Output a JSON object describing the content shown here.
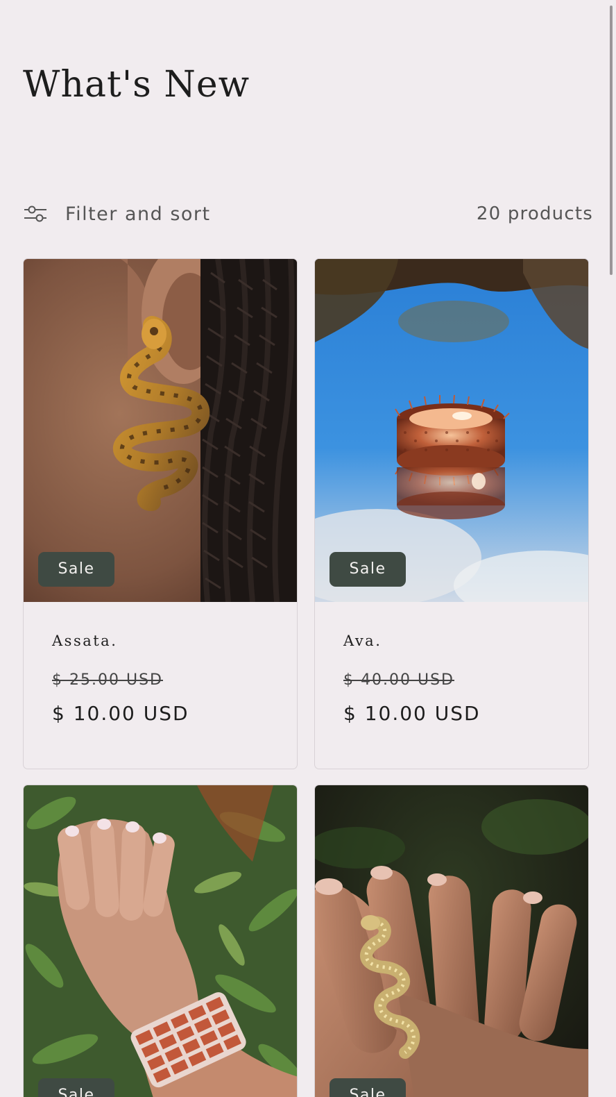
{
  "page": {
    "title": "What's New"
  },
  "toolbar": {
    "filter_label": "Filter and sort",
    "filter_icon": "sliders-icon",
    "product_count": "20 products"
  },
  "products": [
    {
      "name": "Assata.",
      "badge": "Sale",
      "compare_price": "$ 25.00 USD",
      "price": "$ 10.00 USD",
      "image": "tortoiseshell snake earring worn on ear"
    },
    {
      "name": "Ava.",
      "badge": "Sale",
      "compare_price": "$ 40.00 USD",
      "price": "$ 10.00 USD",
      "image": "rose gold spiked ring against blue sky"
    },
    {
      "name": "",
      "badge": "Sale",
      "compare_price": "",
      "price": "",
      "image": "rose gold link bracelet on wrist with greenery"
    },
    {
      "name": "",
      "badge": "Sale",
      "compare_price": "",
      "price": "",
      "image": "gold snake ring on finger"
    }
  ],
  "colors": {
    "background": "#f1ecef",
    "sale_badge": "#3f4a43",
    "text": "#1d1d1d",
    "muted_text": "#555555"
  }
}
